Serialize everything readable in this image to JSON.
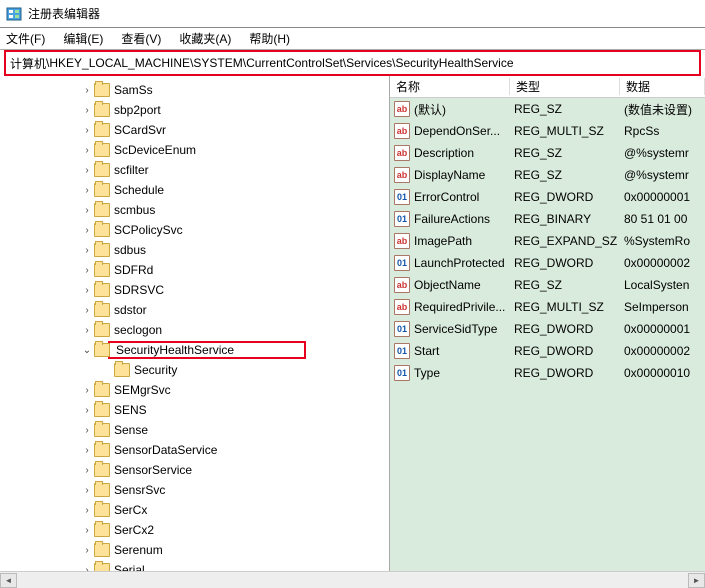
{
  "title": "注册表编辑器",
  "menu": {
    "file": "文件(F)",
    "edit": "编辑(E)",
    "view": "查看(V)",
    "fav": "收藏夹(A)",
    "help": "帮助(H)"
  },
  "address": {
    "prefix": "计算机",
    "path": "\\HKEY_LOCAL_MACHINE\\SYSTEM\\CurrentControlSet\\Services\\SecurityHealthService"
  },
  "tree": [
    {
      "label": "SamSs",
      "exp": "closed"
    },
    {
      "label": "sbp2port",
      "exp": "closed"
    },
    {
      "label": "SCardSvr",
      "exp": "closed"
    },
    {
      "label": "ScDeviceEnum",
      "exp": "closed"
    },
    {
      "label": "scfilter",
      "exp": "closed"
    },
    {
      "label": "Schedule",
      "exp": "closed"
    },
    {
      "label": "scmbus",
      "exp": "closed"
    },
    {
      "label": "SCPolicySvc",
      "exp": "closed"
    },
    {
      "label": "sdbus",
      "exp": "closed"
    },
    {
      "label": "SDFRd",
      "exp": "closed"
    },
    {
      "label": "SDRSVC",
      "exp": "closed"
    },
    {
      "label": "sdstor",
      "exp": "closed"
    },
    {
      "label": "seclogon",
      "exp": "closed"
    },
    {
      "label": "SecurityHealthService",
      "exp": "open",
      "selected": true
    },
    {
      "label": "Security",
      "exp": "none",
      "child": true
    },
    {
      "label": "SEMgrSvc",
      "exp": "closed"
    },
    {
      "label": "SENS",
      "exp": "closed"
    },
    {
      "label": "Sense",
      "exp": "closed"
    },
    {
      "label": "SensorDataService",
      "exp": "closed"
    },
    {
      "label": "SensorService",
      "exp": "closed"
    },
    {
      "label": "SensrSvc",
      "exp": "closed"
    },
    {
      "label": "SerCx",
      "exp": "closed"
    },
    {
      "label": "SerCx2",
      "exp": "closed"
    },
    {
      "label": "Serenum",
      "exp": "closed"
    },
    {
      "label": "Serial",
      "exp": "closed"
    }
  ],
  "cols": {
    "name": "名称",
    "type": "类型",
    "data": "数据"
  },
  "values": [
    {
      "name": "(默认)",
      "type": "REG_SZ",
      "data": "(数值未设置)",
      "icon": "str"
    },
    {
      "name": "DependOnSer...",
      "type": "REG_MULTI_SZ",
      "data": "RpcSs",
      "icon": "str"
    },
    {
      "name": "Description",
      "type": "REG_SZ",
      "data": "@%systemr",
      "icon": "str"
    },
    {
      "name": "DisplayName",
      "type": "REG_SZ",
      "data": "@%systemr",
      "icon": "str"
    },
    {
      "name": "ErrorControl",
      "type": "REG_DWORD",
      "data": "0x00000001",
      "icon": "bin"
    },
    {
      "name": "FailureActions",
      "type": "REG_BINARY",
      "data": "80 51 01 00",
      "icon": "bin"
    },
    {
      "name": "ImagePath",
      "type": "REG_EXPAND_SZ",
      "data": "%SystemRo",
      "icon": "str"
    },
    {
      "name": "LaunchProtected",
      "type": "REG_DWORD",
      "data": "0x00000002",
      "icon": "bin"
    },
    {
      "name": "ObjectName",
      "type": "REG_SZ",
      "data": "LocalSysten",
      "icon": "str"
    },
    {
      "name": "RequiredPrivile...",
      "type": "REG_MULTI_SZ",
      "data": "SeImperson",
      "icon": "str"
    },
    {
      "name": "ServiceSidType",
      "type": "REG_DWORD",
      "data": "0x00000001",
      "icon": "bin"
    },
    {
      "name": "Start",
      "type": "REG_DWORD",
      "data": "0x00000002",
      "icon": "bin"
    },
    {
      "name": "Type",
      "type": "REG_DWORD",
      "data": "0x00000010",
      "icon": "bin"
    }
  ]
}
